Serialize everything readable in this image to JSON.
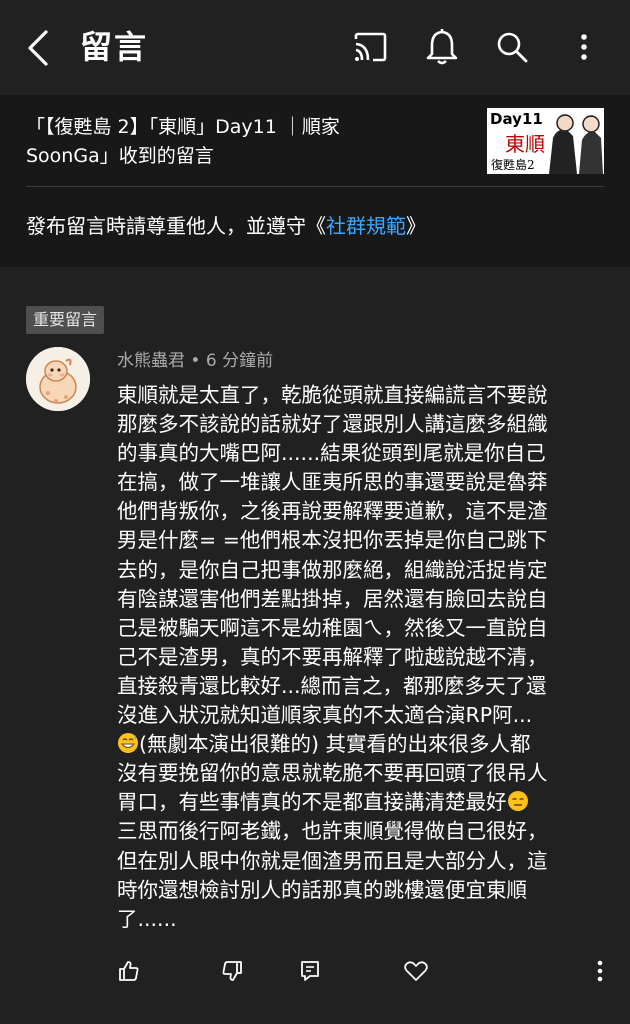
{
  "header": {
    "title": "留言",
    "icons": [
      "back-arrow-icon",
      "cast-icon",
      "bell-icon",
      "search-icon",
      "more-vert-icon"
    ]
  },
  "video": {
    "title_line1": "「【復甦島 2】「東順」Day11 ｜順家",
    "title_line2": "SoonGa」收到的留言",
    "thumb_day": "Day11",
    "thumb_name": "東順",
    "thumb_show": "復甦島2"
  },
  "notice": {
    "prefix": "發布留言時請尊重他人，並遵守《",
    "link": "社群規範",
    "suffix": "》"
  },
  "comment": {
    "badge": "重要留言",
    "author": "水熊蟲君",
    "separator": " • ",
    "time": "6 分鐘前",
    "lines": [
      "東順就是太直了，乾脆從頭就直接編謊言不要說",
      "那麼多不該說的話就好了還跟別人講這麼多組織",
      "的事真的大嘴巴阿......結果從頭到尾就是你自己",
      "在搞，做了一堆讓人匪夷所思的事還要說是魯莽",
      "他們背叛你，之後再說要解釋要道歉，這不是渣",
      "男是什麼= =他們根本沒把你丟掉是你自己跳下",
      "去的，是你自己把事做那麼絕，組織說活捉肯定",
      "有陰謀還害他們差點掛掉，居然還有臉回去說自",
      "己是被騙天啊這不是幼稚園ㄟ，然後又一直說自",
      "己不是渣男，真的不要再解釋了啦越說越不清，",
      "直接殺青還比較好...總而言之，都那麼多天了還",
      "沒進入狀況就知道順家真的不太適合演RP阿..."
    ],
    "line13": "(無劇本演出很難的) 其實看的出來很多人都",
    "line14": "沒有要挽留你的意思就乾脆不要再回頭了很吊人",
    "line15": "胃口，有些事情真的不是都直接講清楚最好",
    "lines_after": [
      "三思而後行阿老鐵，也許東順覺得做自己很好，",
      "但在別人眼中你就是個渣男而且是大部分人，這",
      "時你還想檢討別人的話那真的跳樓還便宜東順",
      "了......"
    ],
    "emoji1": "sweat-smile-emoji",
    "emoji2": "expressionless-emoji"
  },
  "actions": {
    "icons": [
      "thumb-up-icon",
      "thumb-down-icon",
      "reply-icon",
      "heart-icon",
      "more-vert-icon"
    ]
  },
  "colors": {
    "background": "#212121",
    "video_panel": "#181818",
    "link": "#3ea6ff",
    "badge_bg": "#4f4f4f",
    "meta_text": "#aaaaaa"
  }
}
